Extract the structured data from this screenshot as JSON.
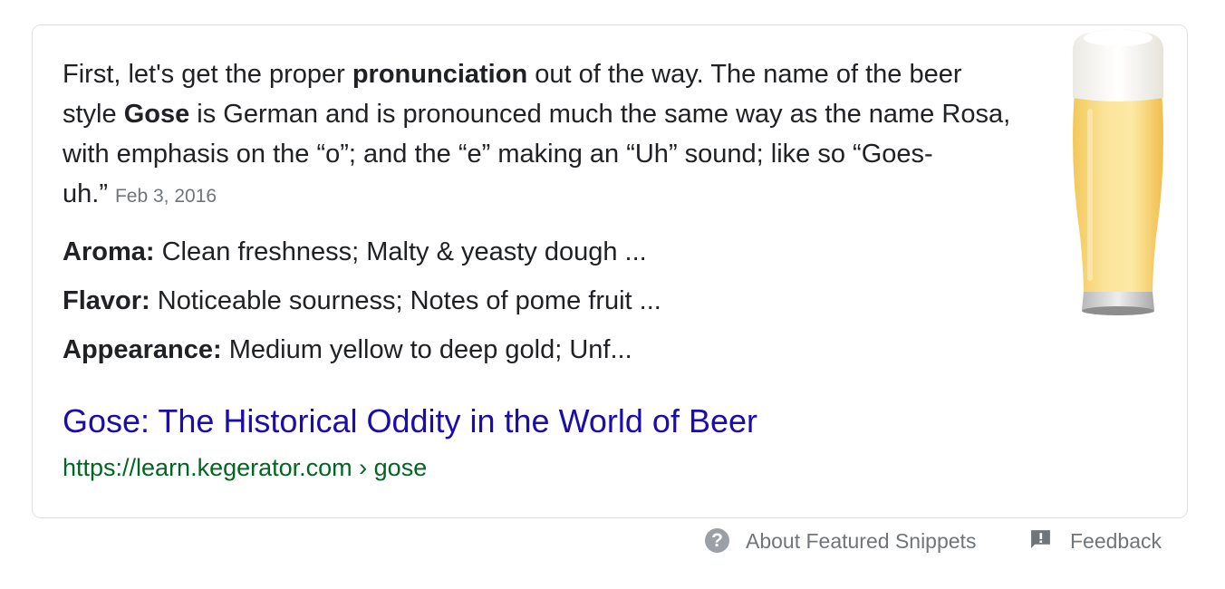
{
  "snippet": {
    "part1": "First, let's get the proper ",
    "bold1": "pronunciation",
    "part2": " out of the way. The name of the beer style ",
    "bold2": "Gose",
    "part3": " is German and is pronounced much the same way as the name Rosa, with emphasis on the “o”; and the “e” making an “Uh” sound; like so “Goes-uh.”",
    "date": "Feb 3, 2016"
  },
  "facts": [
    {
      "label": "Aroma:",
      "value": " Clean freshness; Malty & yeasty dough ..."
    },
    {
      "label": "Flavor:",
      "value": " Noticeable sourness; Notes of pome fruit ..."
    },
    {
      "label": "Appearance:",
      "value": " Medium yellow to deep gold; Unf..."
    }
  ],
  "result": {
    "title": "Gose: The Historical Oddity in the World of Beer",
    "url": "https://learn.kegerator.com › gose"
  },
  "footer": {
    "about_label": "About Featured Snippets",
    "about_icon": "help-icon",
    "feedback_label": "Feedback",
    "feedback_icon": "feedback-icon"
  },
  "colors": {
    "link": "#1a0dab",
    "url": "#006621",
    "text": "#202124",
    "muted": "#70757a",
    "border": "#dfe1e5"
  }
}
